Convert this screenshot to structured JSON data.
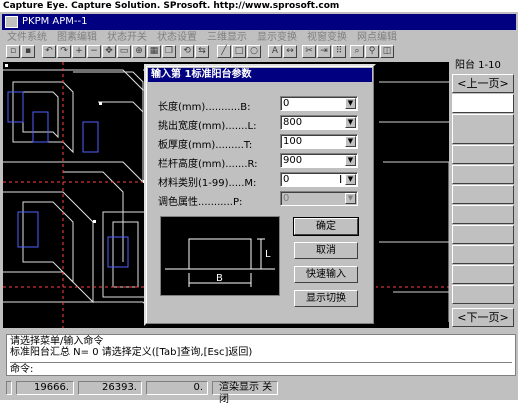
{
  "banner": "Capture Eye.  Capture Solution.  SProsoft.  http://www.sprosoft.com",
  "window": {
    "title": "PKPM  APM--1"
  },
  "menu": [
    "文件系统",
    "图素编辑",
    "状态开关",
    "状态设置",
    "三维显示",
    "显示变换",
    "视窗变换",
    "网点编辑"
  ],
  "right_panel": {
    "title": "阳台 1-10",
    "prev": "<上一页>",
    "next": "<下一页>"
  },
  "dialog": {
    "title": "输入第   1标准阳台参数",
    "rows": [
      {
        "label": "长度(mm)...........B:",
        "value": "0",
        "disabled": false
      },
      {
        "label": "挑出宽度(mm).......L:",
        "value": "800",
        "disabled": false
      },
      {
        "label": "板厚度(mm).........T:",
        "value": "100",
        "disabled": false
      },
      {
        "label": "栏杆高度(mm).......R:",
        "value": "900",
        "disabled": false
      },
      {
        "label": "材料类别(1-99).....M:",
        "value": "0",
        "disabled": false
      },
      {
        "label": "调色属性...........P:",
        "value": "0",
        "disabled": true
      }
    ],
    "buttons": {
      "ok": "确定",
      "cancel": "取消",
      "quick": "快速输入",
      "toggle": "显示切换"
    },
    "preview": {
      "label_b": "B",
      "label_l": "L"
    }
  },
  "command": {
    "line1": "请选择菜单/输入命令",
    "line2": "标准阳台汇总 N=   0 请选择定义([Tab]查询,[Esc]返回)",
    "prompt": "命令:"
  },
  "status": {
    "x": "19666.",
    "y": "26393.",
    "z": "0.",
    "render": "渲染显示  关闭"
  }
}
